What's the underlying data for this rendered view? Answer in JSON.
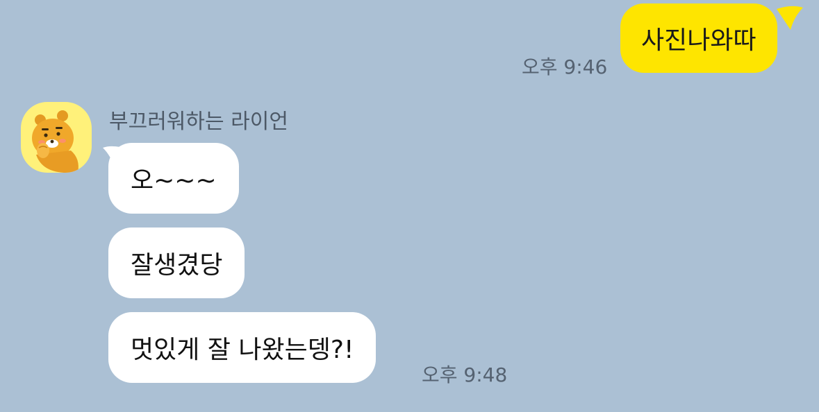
{
  "outgoing": {
    "message": "사진나와따",
    "time": "오후 9:46"
  },
  "incoming": {
    "sender_name": "부끄러워하는 라이언",
    "messages": [
      {
        "text": "오~~~"
      },
      {
        "text": "잘생겼당"
      },
      {
        "text": "멋있게 잘 나왔는뎅?!"
      }
    ],
    "time": "오후 9:48"
  },
  "colors": {
    "background": "#abc0d4",
    "outgoing_bubble": "#fee500",
    "incoming_bubble": "#ffffff",
    "avatar_bg": "#fff17a",
    "timestamp": "#556271"
  },
  "icons": {
    "avatar": "ryan-bear-icon"
  }
}
